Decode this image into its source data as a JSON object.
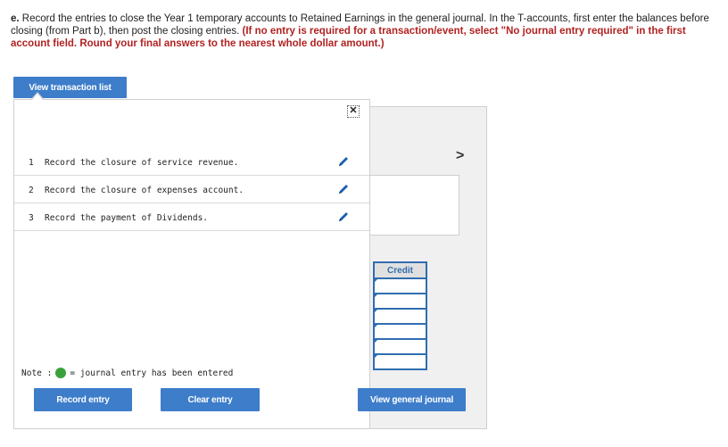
{
  "instructions": {
    "part_label": "e.",
    "text": "Record the entries to close the Year 1 temporary accounts to Retained Earnings in the general journal. In the T-accounts, first enter the balances before closing (from Part b), then post the closing entries.",
    "emphasis": "(If no entry is required for a transaction/event, select \"No journal entry required\" in the first account field. Round your final answers to the nearest whole dollar amount.)"
  },
  "buttons": {
    "view_transaction_list": "View transaction list",
    "record_entry": "Record entry",
    "clear_entry": "Clear entry",
    "view_general_journal": "View general journal"
  },
  "popup": {
    "close_glyph": "✕",
    "transactions": [
      {
        "num": "1",
        "text": "Record the closure of service revenue."
      },
      {
        "num": "2",
        "text": "Record the closure of expenses account."
      },
      {
        "num": "3",
        "text": "Record the payment of Dividends."
      }
    ],
    "note_label": "Note :",
    "note_text": "= journal entry has been entered"
  },
  "background": {
    "next_glyph": ">",
    "credit_header": "Credit"
  },
  "colors": {
    "button_blue": "#3d7dca",
    "instruction_red": "#b22222",
    "entered_green": "#3aa13a",
    "pencil_blue": "#1a5fb4"
  },
  "icons": {
    "edit": "pencil-icon",
    "close": "close-icon",
    "next": "chevron-right-icon",
    "entered": "green-dot-icon"
  }
}
